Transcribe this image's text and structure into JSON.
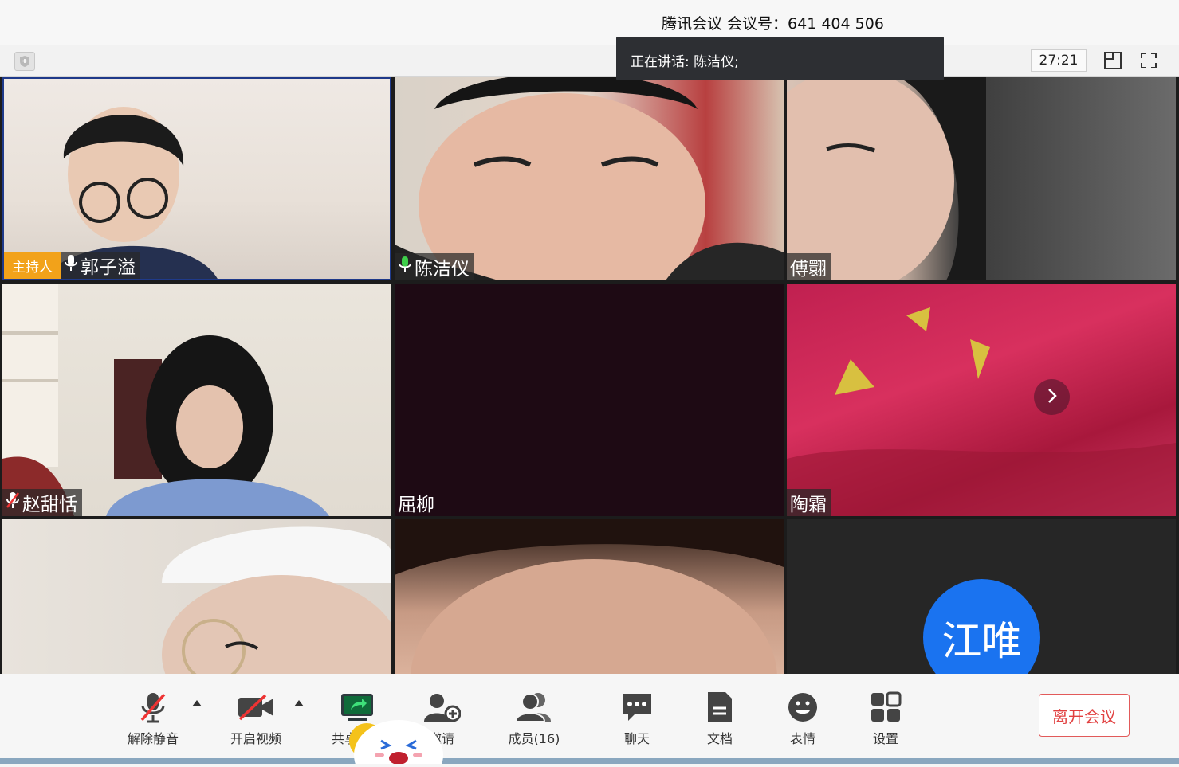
{
  "window": {
    "title": "腾讯会议 会议号：641 404 506",
    "timer": "27:21"
  },
  "speaking_banner": "正在讲话: 陈洁仪;",
  "participants": [
    {
      "name": "郭子溢",
      "host_tag": "主持人",
      "mic": "on"
    },
    {
      "name": "陈洁仪",
      "mic": "active"
    },
    {
      "name": "傅翾"
    },
    {
      "name": "赵甜恬",
      "mic": "muted"
    },
    {
      "name": "屈柳"
    },
    {
      "name": "陶霜"
    },
    {
      "name": ""
    },
    {
      "name": ""
    },
    {
      "name": "",
      "avatar_text": "江唯"
    }
  ],
  "controls": {
    "unmute": "解除静音",
    "video": "开启视频",
    "share": "共享屏幕",
    "invite": "邀请",
    "members": "成员(16)",
    "chat": "聊天",
    "docs": "文档",
    "emoji": "表情",
    "settings": "设置",
    "leave": "离开会议"
  },
  "colors": {
    "host_tag": "#f2a21a",
    "avatar": "#1a73f0",
    "leave": "#e14040",
    "mic_active": "#3ecf4a"
  },
  "icons": [
    "shield-icon",
    "layout-icon",
    "fullscreen-icon",
    "mic-muted-icon",
    "video-off-icon",
    "share-screen-icon",
    "invite-icon",
    "members-icon",
    "chat-icon",
    "docs-icon",
    "emoji-icon",
    "settings-icon",
    "chevron-right-icon"
  ]
}
